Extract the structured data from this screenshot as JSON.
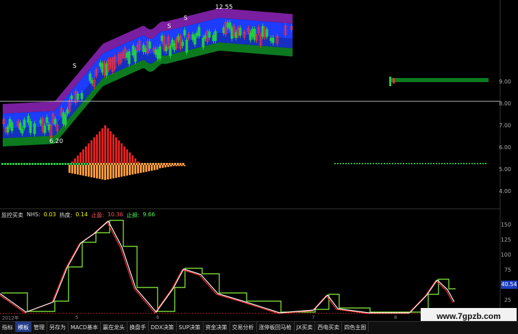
{
  "info_bar": {
    "title": "监控买卖",
    "nhs_label": "NHS:",
    "nhs_value": "0.03",
    "heat_label": "热度:",
    "heat_value": "0.14",
    "stop_profit_label": "止盈:",
    "stop_profit_value": "10.36",
    "stop_loss_label": "止损:",
    "stop_loss_value": "9.66"
  },
  "price_annotations": {
    "high": "12.55",
    "low": "6.20",
    "s_marker": "S"
  },
  "price_axis": [
    "9.00",
    "8.00",
    "7.00",
    "6.00",
    "5.00",
    "4.00"
  ],
  "indicator_axis": [
    "150",
    "125",
    "100",
    "75",
    "50",
    "25"
  ],
  "indicator_current": "40.54",
  "time_axis": {
    "year": "2012年",
    "months": [
      "5",
      "6",
      "7",
      "8"
    ]
  },
  "tabs": [
    "指标",
    "模板",
    "管理",
    "另存为",
    "MACD基本",
    "赢在龙头",
    "换盘手",
    "DDX决策",
    "SUP决策",
    "资金决策",
    "交易分析",
    "涨停板回马枪",
    "JX买卖",
    "西电买卖",
    "四色主图"
  ],
  "active_tab": "模板",
  "watermark": "www.7gpzb.com",
  "colors": {
    "band_purple": "#7a1fa0",
    "band_blue": "#1c3cff",
    "band_green": "#0d7a20",
    "up": "#ff3030",
    "down": "#22cc44"
  }
}
